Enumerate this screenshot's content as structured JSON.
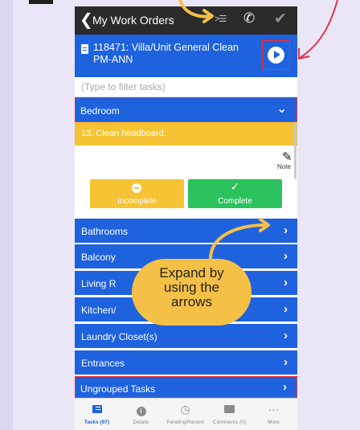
{
  "nav": {
    "back_glyph": "❮",
    "title": "My Work Orders",
    "list_glyph": ">☰",
    "phone_glyph": "✆",
    "check_glyph": "✔"
  },
  "work_order": {
    "line1": "118471: Villa/Unit General Clean",
    "line2": "PM-ANN"
  },
  "filter": {
    "placeholder": "(Type to filter tasks)"
  },
  "expanded_group": {
    "label": "Bedroom",
    "chevron": "⌄"
  },
  "task": {
    "text": "13. Clean headboard."
  },
  "note": {
    "icon_glyph": "✎",
    "label": "Note"
  },
  "buttons": {
    "incomplete": "Incomplete",
    "complete": "Complete",
    "check_glyph": "✓"
  },
  "groups": [
    {
      "label": "Bathrooms"
    },
    {
      "label": "Balcony"
    },
    {
      "label": "Living R"
    },
    {
      "label": "Kitchen/"
    },
    {
      "label": "Laundry Closet(s)"
    },
    {
      "label": "Entrances"
    },
    {
      "label": "Ungrouped Tasks"
    }
  ],
  "group_chevron": "›",
  "tabs": [
    {
      "label": "Tasks (97)",
      "icon": "list-icon",
      "active": true
    },
    {
      "label": "Details",
      "icon": "info-icon",
      "glyph": "i"
    },
    {
      "label": "Pending/Recent",
      "icon": "clock-icon",
      "glyph": "◷"
    },
    {
      "label": "Comments (0)",
      "icon": "image-icon"
    },
    {
      "label": "More",
      "icon": "more-icon",
      "glyph": "···"
    }
  ],
  "callout": {
    "line1": "Expand by",
    "line2": "using the",
    "line3": "arrows"
  },
  "colors": {
    "accent_blue": "#1e62de",
    "task_yellow": "#f5c334",
    "complete_green": "#2bc25d",
    "annotation_red": "#ff2a2a",
    "callout_yellow": "#f5c046"
  }
}
